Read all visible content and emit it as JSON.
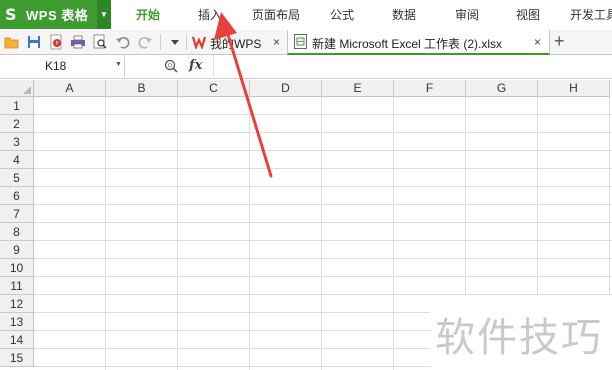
{
  "app": {
    "title": "WPS 表格",
    "logo_glyph": "S",
    "accent": "#3d9b2f"
  },
  "menu": [
    {
      "label": "开始",
      "active": true
    },
    {
      "label": "插入"
    },
    {
      "label": "页面布局"
    },
    {
      "label": "公式"
    },
    {
      "label": "数据"
    },
    {
      "label": "审阅"
    },
    {
      "label": "视图"
    },
    {
      "label": "开发工具"
    }
  ],
  "toolbar": {
    "icons": [
      "open-icon",
      "save-icon",
      "pdf-export-icon",
      "print-icon",
      "print-preview-icon",
      "undo-icon",
      "redo-icon",
      "more-dropdown-icon"
    ]
  },
  "tabs": [
    {
      "label": "我的WPS",
      "close": "×",
      "active": false
    },
    {
      "label": "新建 Microsoft Excel 工作表 (2).xlsx",
      "close": "×",
      "active": true
    }
  ],
  "new_tab": "+",
  "formula_bar": {
    "cell_ref": "K18",
    "fx": "fx",
    "formula": ""
  },
  "columns": [
    "A",
    "B",
    "C",
    "D",
    "E",
    "F",
    "G",
    "H"
  ],
  "rows": [
    "1",
    "2",
    "3",
    "4",
    "5",
    "6",
    "7",
    "8",
    "9",
    "10",
    "11",
    "12",
    "13",
    "14",
    "15"
  ],
  "watermark": "软件技巧",
  "annotation": {
    "color": "#e8403a",
    "points_to": "插入"
  }
}
